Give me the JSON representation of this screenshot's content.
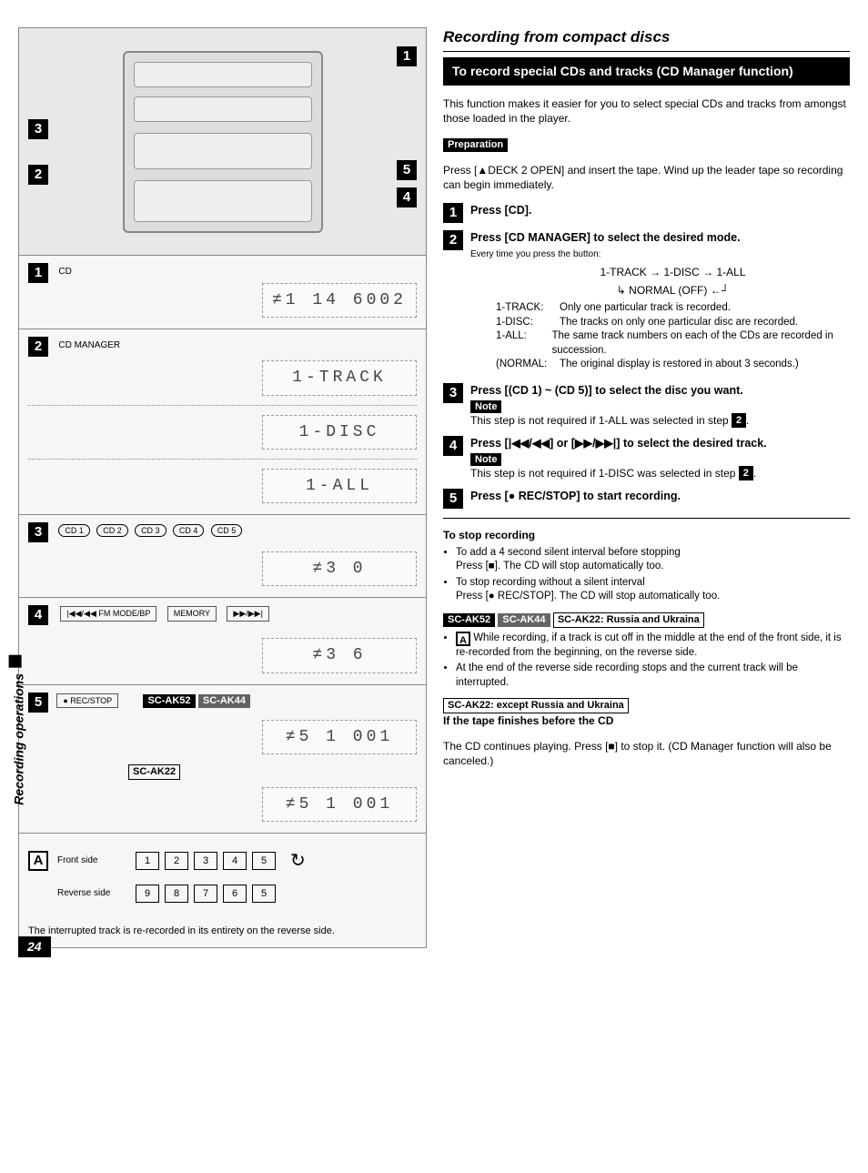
{
  "side_label": "Recording operations",
  "page_number": "24",
  "left": {
    "markers": {
      "m1": "1",
      "m2": "2",
      "m3": "3",
      "m4": "4",
      "m5": "5"
    },
    "step1": {
      "num": "1",
      "btn_label": "CD",
      "lcd": "≠1   14  6002"
    },
    "step2": {
      "num": "2",
      "btn_label": "CD MANAGER",
      "lcd1": "1-TRACK",
      "lcd2": "1-DISC",
      "lcd3": "1-ALL"
    },
    "step3": {
      "num": "3",
      "cd_buttons": [
        "CD 1",
        "CD 2",
        "CD 3",
        "CD 4",
        "CD 5"
      ],
      "lcd": "≠3        0"
    },
    "step4": {
      "num": "4",
      "btn_left": "|◀◀/◀◀ FM MODE/BP",
      "btn_mid": "MEMORY",
      "btn_right": "▶▶/▶▶|",
      "lcd": "≠3      6"
    },
    "step5": {
      "num": "5",
      "rec_btn": "● REC/STOP",
      "model_tags": [
        "SC-AK52",
        "SC-AK44"
      ],
      "lcd1": "≠5     1   001",
      "model_tag2": "SC-AK22",
      "lcd2": "≠5     1   001"
    },
    "box_a": {
      "letter": "A",
      "front_label": "Front side",
      "reverse_label": "Reverse side",
      "front_seq": [
        "1",
        "2",
        "3",
        "4",
        "5"
      ],
      "reverse_seq": [
        "9",
        "8",
        "7",
        "6",
        "5"
      ],
      "caption": "The interrupted track is re-recorded in its entirety on the reverse side."
    }
  },
  "right": {
    "title": "Recording from compact discs",
    "subtitle": "To record special CDs and tracks (CD Manager function)",
    "intro": "This function makes it easier for you to select special CDs and tracks from amongst those loaded in the player.",
    "prep_label": "Preparation",
    "prep_text": "Press [▲DECK 2 OPEN] and insert the tape. Wind up the leader tape so recording can begin immediately.",
    "s1": {
      "num": "1",
      "text": "Press [CD]."
    },
    "s2": {
      "num": "2",
      "head": "Press [CD MANAGER] to select the desired mode.",
      "sub": "Every time you press the button:",
      "flow_top": "1-TRACK → 1-DISC → 1-ALL",
      "flow_bottom": "NORMAL (OFF)",
      "rows": [
        {
          "k": "1-TRACK:",
          "v": "Only one particular track is recorded."
        },
        {
          "k": "1-DISC:",
          "v": "The tracks on only one particular disc are recorded."
        },
        {
          "k": "1-ALL:",
          "v": "The same track numbers on each of the CDs are recorded in succession."
        },
        {
          "k": "(NORMAL:",
          "v": "The original display is restored in about 3 seconds.)"
        }
      ]
    },
    "s3": {
      "num": "3",
      "head": "Press [(CD 1) ~ (CD 5)] to select the disc you want.",
      "note_label": "Note",
      "note": "This step is not required if 1-ALL was selected in step",
      "note_ref": "2"
    },
    "s4": {
      "num": "4",
      "head": "Press [|◀◀/◀◀] or [▶▶/▶▶|] to select the desired track.",
      "note_label": "Note",
      "note": "This step is not required if 1-DISC was selected in step",
      "note_ref": "2"
    },
    "s5": {
      "num": "5",
      "head": "Press [● REC/STOP] to start recording."
    },
    "stop": {
      "heading": "To stop recording",
      "b1": "To add a 4 second silent interval before stopping\nPress [■]. The CD will stop automatically too.",
      "b2": "To stop recording without a silent interval\nPress [● REC/STOP]. The CD will stop automatically too."
    },
    "model_line1": {
      "tags": [
        "SC-AK52",
        "SC-AK44"
      ],
      "tag_box": "SC-AK22: Russia and Ukraina",
      "b1_badge": "A",
      "b1": "While recording, if a track is cut off in the middle at the end of the front side, it is re-recorded from the beginning, on the reverse side.",
      "b2": "At the end of the reverse side recording stops and the current track will be interrupted."
    },
    "model_line2": {
      "tag_box": "SC-AK22: except Russia and Ukraina",
      "sub": "If the tape finishes before the CD",
      "text": "The CD continues playing. Press [■] to stop it. (CD Manager function will also be canceled.)"
    }
  }
}
